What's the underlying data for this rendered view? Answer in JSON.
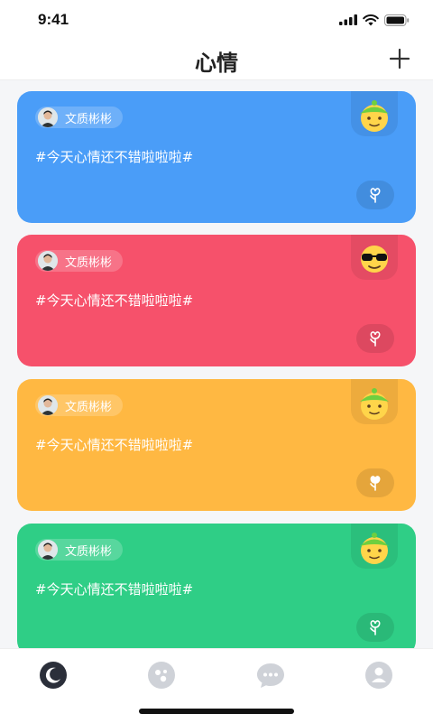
{
  "status_bar": {
    "time": "9:41"
  },
  "header": {
    "title": "心情"
  },
  "posts": [
    {
      "user_name": "文质彬彬",
      "text": "#今天心情还不错啦啦啦#",
      "color": "#4a9df8",
      "mood_icon": "hat-emoji-icon"
    },
    {
      "user_name": "文质彬彬",
      "text": "#今天心情还不错啦啦啦#",
      "color": "#f6516b",
      "mood_icon": "sunglasses-emoji-icon"
    },
    {
      "user_name": "文质彬彬",
      "text": "#今天心情还不错啦啦啦#",
      "color": "#ffb842",
      "mood_icon": "hat-emoji-icon"
    },
    {
      "user_name": "文质彬彬",
      "text": "#今天心情还不错啦啦啦#",
      "color": "#2fce86",
      "mood_icon": "hat-emoji-icon"
    }
  ],
  "tab_bar": {
    "tabs": [
      {
        "icon": "moon-icon",
        "active": true
      },
      {
        "icon": "discover-icon",
        "active": false
      },
      {
        "icon": "chat-icon",
        "active": false
      },
      {
        "icon": "profile-icon",
        "active": false
      }
    ],
    "active_color": "#2b2f3a",
    "inactive_color": "#cfd2d8"
  }
}
